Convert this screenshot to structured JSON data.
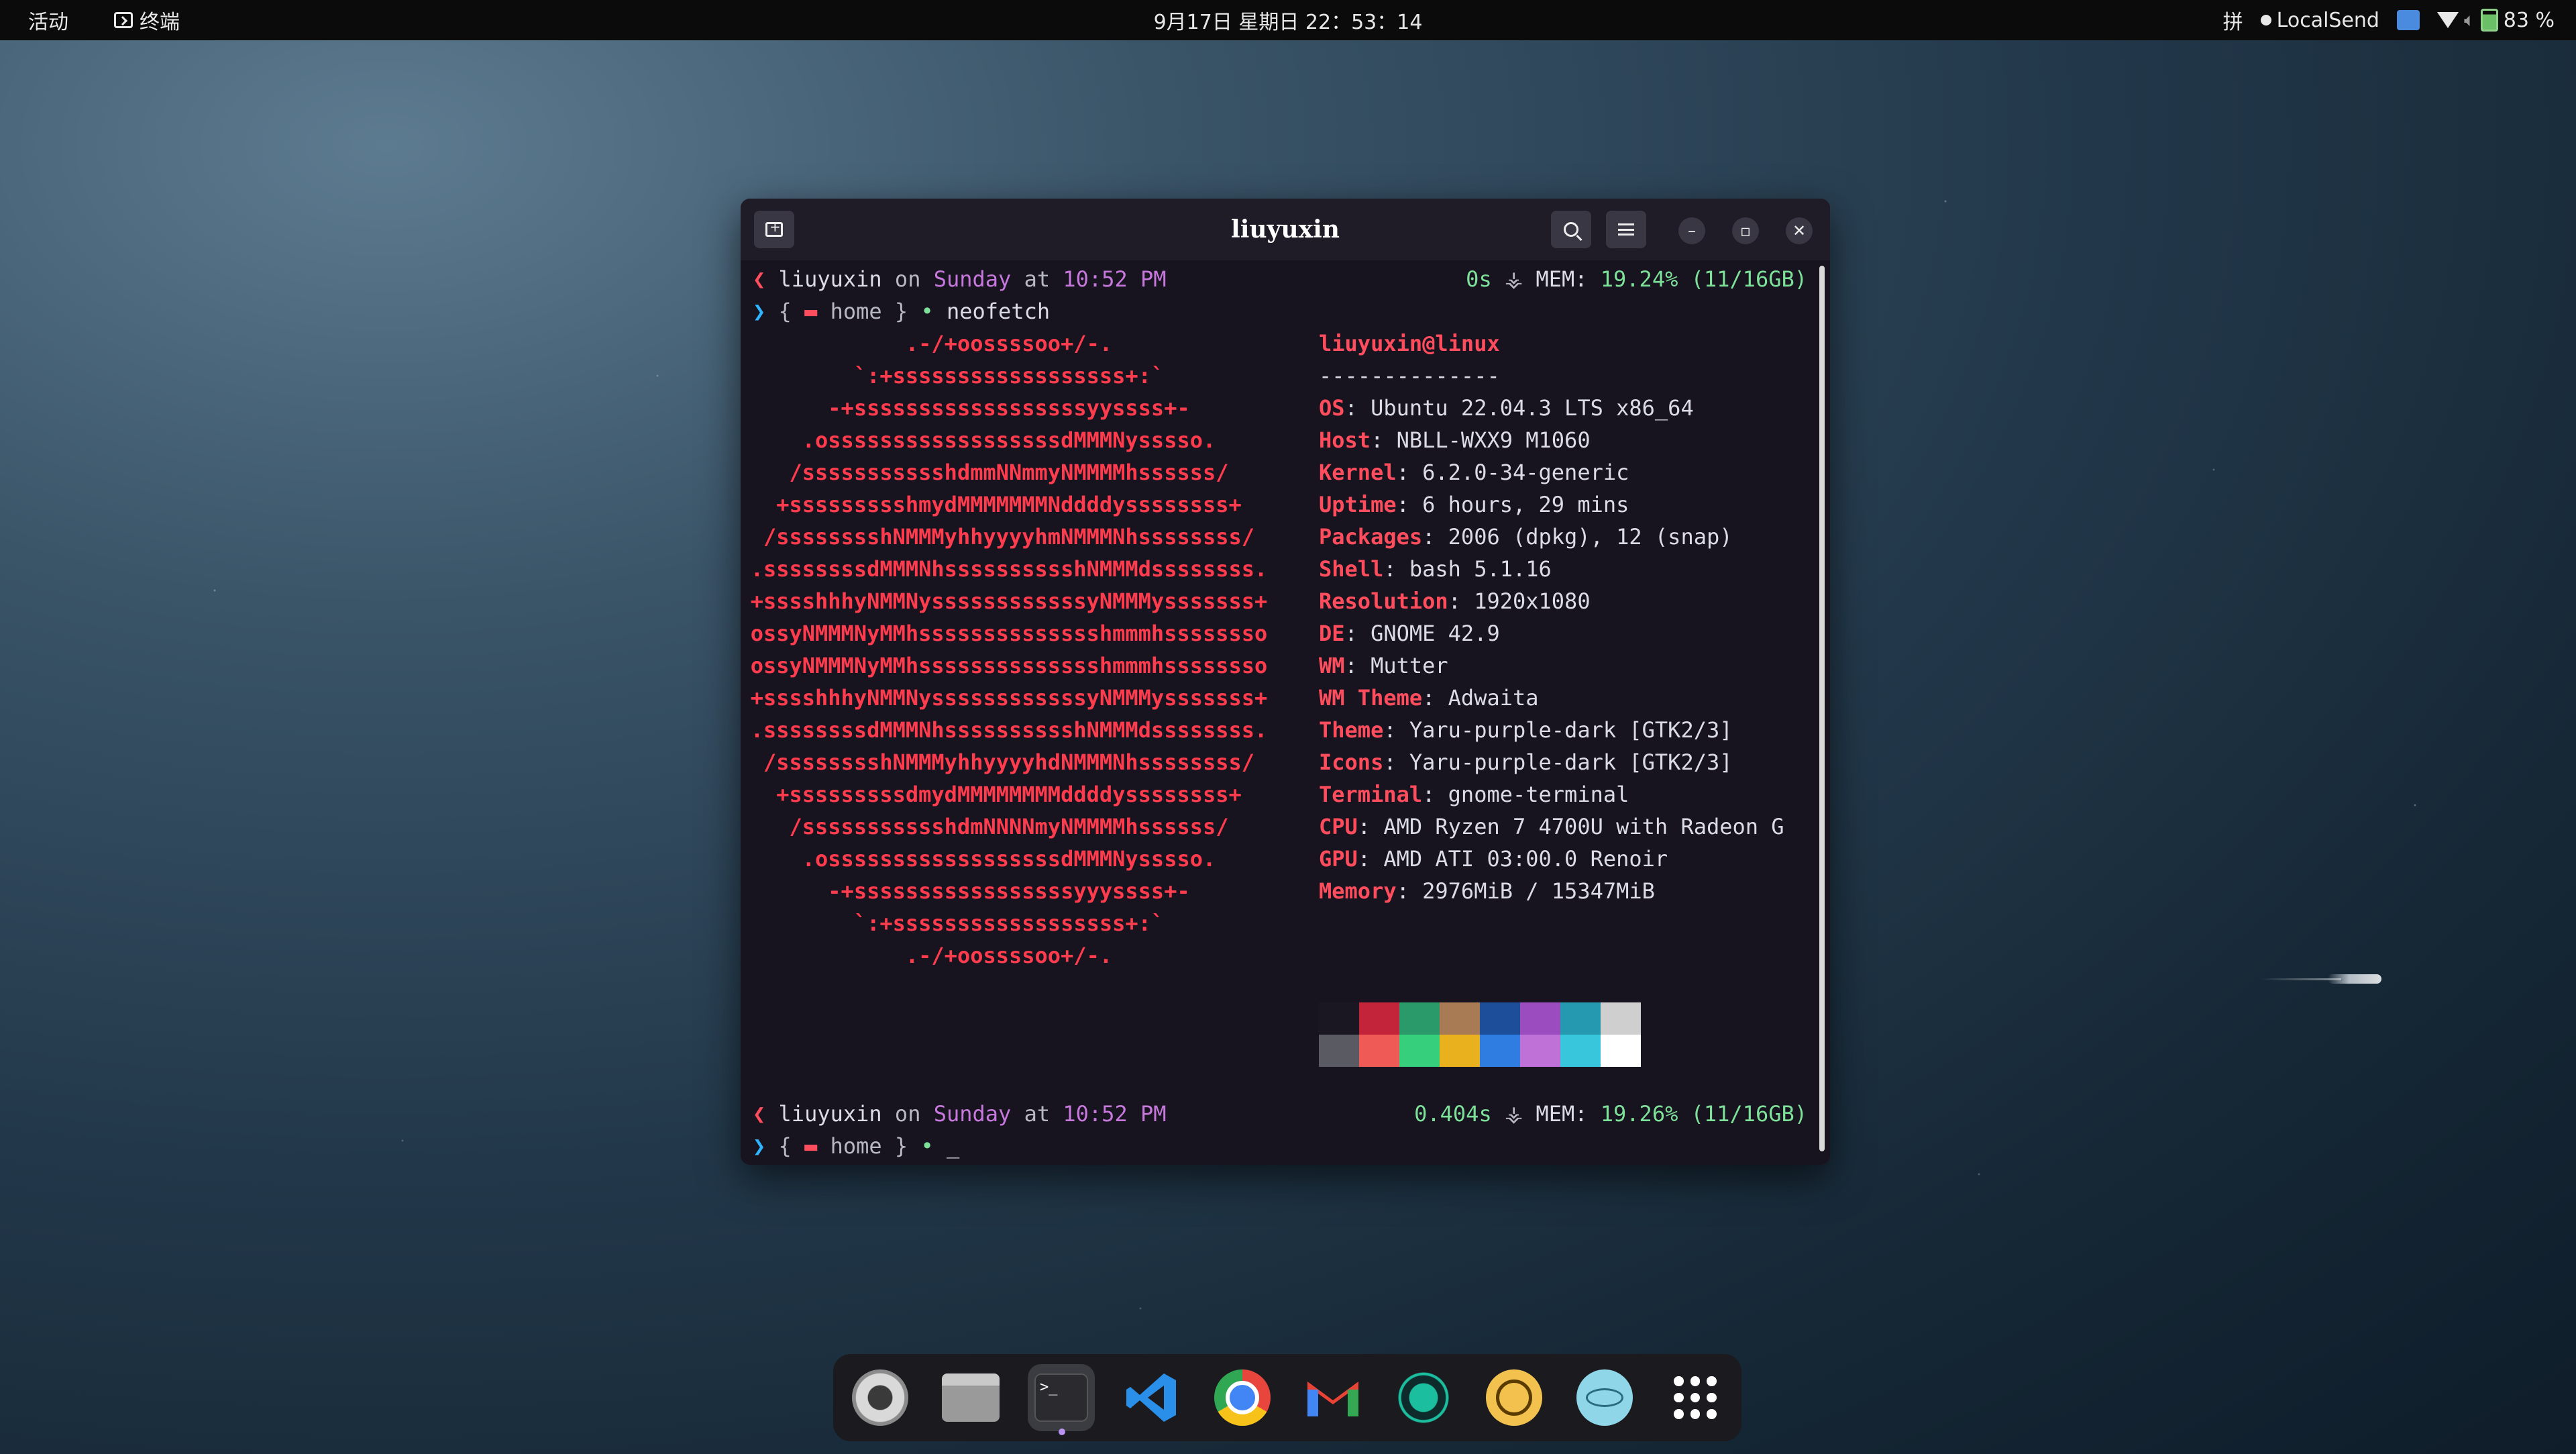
{
  "topbar": {
    "activities": "活动",
    "app_name": "终端",
    "clock": "9月17日 星期日 22：53：14",
    "input_method": "拼",
    "localsend": "LocalSend",
    "battery": "83 %"
  },
  "window": {
    "title": "liuyuxin"
  },
  "terminal": {
    "prompt1": {
      "user": "liuyuxin",
      "on": "on",
      "day": "Sunday",
      "at": "at",
      "time": "10:52 PM",
      "duration": "0s",
      "mem_label": "MEM:",
      "mem_value": "19.24% (11/16GB)"
    },
    "cmd_line": {
      "open_brace": "{",
      "dir": "home",
      "close_brace": "}",
      "command": "neofetch"
    },
    "ascii_art": [
      ".-/+oossssoo+/-.",
      "`:+ssssssssssssssssss+:`",
      "-+ssssssssssssssssssyyssss+-",
      ".ossssssssssssssssssdMMMNysssso.",
      "/ssssssssssshdmmNNmmyNMMMMhssssss/",
      "+ssssssssshmydMMMMMMMNddddyssssssss+",
      "/sssssssshNMMMyhhyyyyhmNMMMNhssssssss/",
      ".ssssssssdMMMNhsssssssssshNMMMdssssssss.",
      "+sssshhhyNMMNyssssssssssssyNMMMysssssss+",
      "ossyNMMMNyMMhsssssssssssssshmmmhssssssso",
      "ossyNMMMNyMMhsssssssssssssshmmmhssssssso",
      "+sssshhhyNMMNyssssssssssssyNMMMysssssss+",
      ".ssssssssdMMMNhsssssssssshNMMMdssssssss.",
      "/sssssssshNMMMyhhyyyyhdNMMMNhssssssss/",
      "+sssssssssdmydMMMMMMMMddddyssssssss+",
      "/ssssssssssshdmNNNNmyNMMMMhssssss/",
      ".ossssssssssssssssssdMMMNysssso.",
      "-+sssssssssssssssssyyyssss+-",
      "`:+ssssssssssssssssss+:`",
      ".-/+oossssoo+/-."
    ],
    "info_header": "liuyuxin@linux",
    "info_separator": "--------------",
    "info": [
      {
        "label": "OS",
        "value": "Ubuntu 22.04.3 LTS x86_64"
      },
      {
        "label": "Host",
        "value": "NBLL-WXX9 M1060"
      },
      {
        "label": "Kernel",
        "value": "6.2.0-34-generic"
      },
      {
        "label": "Uptime",
        "value": "6 hours, 29 mins"
      },
      {
        "label": "Packages",
        "value": "2006 (dpkg), 12 (snap)"
      },
      {
        "label": "Shell",
        "value": "bash 5.1.16"
      },
      {
        "label": "Resolution",
        "value": "1920x1080"
      },
      {
        "label": "DE",
        "value": "GNOME 42.9"
      },
      {
        "label": "WM",
        "value": "Mutter"
      },
      {
        "label": "WM Theme",
        "value": "Adwaita"
      },
      {
        "label": "Theme",
        "value": "Yaru-purple-dark [GTK2/3]"
      },
      {
        "label": "Icons",
        "value": "Yaru-purple-dark [GTK2/3]"
      },
      {
        "label": "Terminal",
        "value": "gnome-terminal"
      },
      {
        "label": "CPU",
        "value": "AMD Ryzen 7 4700U with Radeon G"
      },
      {
        "label": "GPU",
        "value": "AMD ATI 03:00.0 Renoir"
      },
      {
        "label": "Memory",
        "value": "2976MiB / 15347MiB"
      }
    ],
    "palette_top": [
      "#1a1723",
      "#c4243a",
      "#2a9a6a",
      "#a87b55",
      "#1d4e9a",
      "#9b4dc0",
      "#2599b0",
      "#cfcfcf"
    ],
    "palette_bottom": [
      "#5a5a62",
      "#ef5a56",
      "#36d07c",
      "#eab11f",
      "#2f7de0",
      "#c071d8",
      "#38c6dc",
      "#ffffff"
    ],
    "prompt2": {
      "user": "liuyuxin",
      "on": "on",
      "day": "Sunday",
      "at": "at",
      "time": "10:52 PM",
      "duration": "0.404s",
      "mem_label": "MEM:",
      "mem_value": "19.26% (11/16GB)"
    },
    "cmd_line2": {
      "open_brace": "{",
      "dir": "home",
      "close_brace": "}",
      "cursor": "_"
    }
  },
  "dock": {
    "items": [
      {
        "name": "settings-icon"
      },
      {
        "name": "files-icon"
      },
      {
        "name": "terminal-icon"
      },
      {
        "name": "vscode-icon"
      },
      {
        "name": "chrome-icon"
      },
      {
        "name": "gmail-icon"
      },
      {
        "name": "app-teal-icon"
      },
      {
        "name": "app-yellow-icon"
      },
      {
        "name": "electron-icon"
      },
      {
        "name": "app-grid-icon"
      }
    ]
  }
}
